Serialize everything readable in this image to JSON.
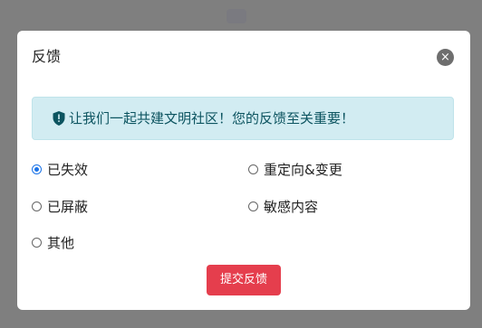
{
  "dialog": {
    "title": "反馈",
    "close_icon": "×",
    "alert": {
      "icon": "shield-icon",
      "text": "让我们一起共建文明社区！您的反馈至关重要！"
    },
    "options": [
      {
        "label": "已失效",
        "checked": true
      },
      {
        "label": "重定向&变更",
        "checked": false
      },
      {
        "label": "已屏蔽",
        "checked": false
      },
      {
        "label": "敏感内容",
        "checked": false
      },
      {
        "label": "其他",
        "checked": false
      }
    ],
    "submit_label": "提交反馈"
  },
  "colors": {
    "accent": "#1a73e8",
    "submit": "#e53e4d",
    "alert_bg": "#d2ecf2",
    "alert_text": "#0c5460"
  }
}
